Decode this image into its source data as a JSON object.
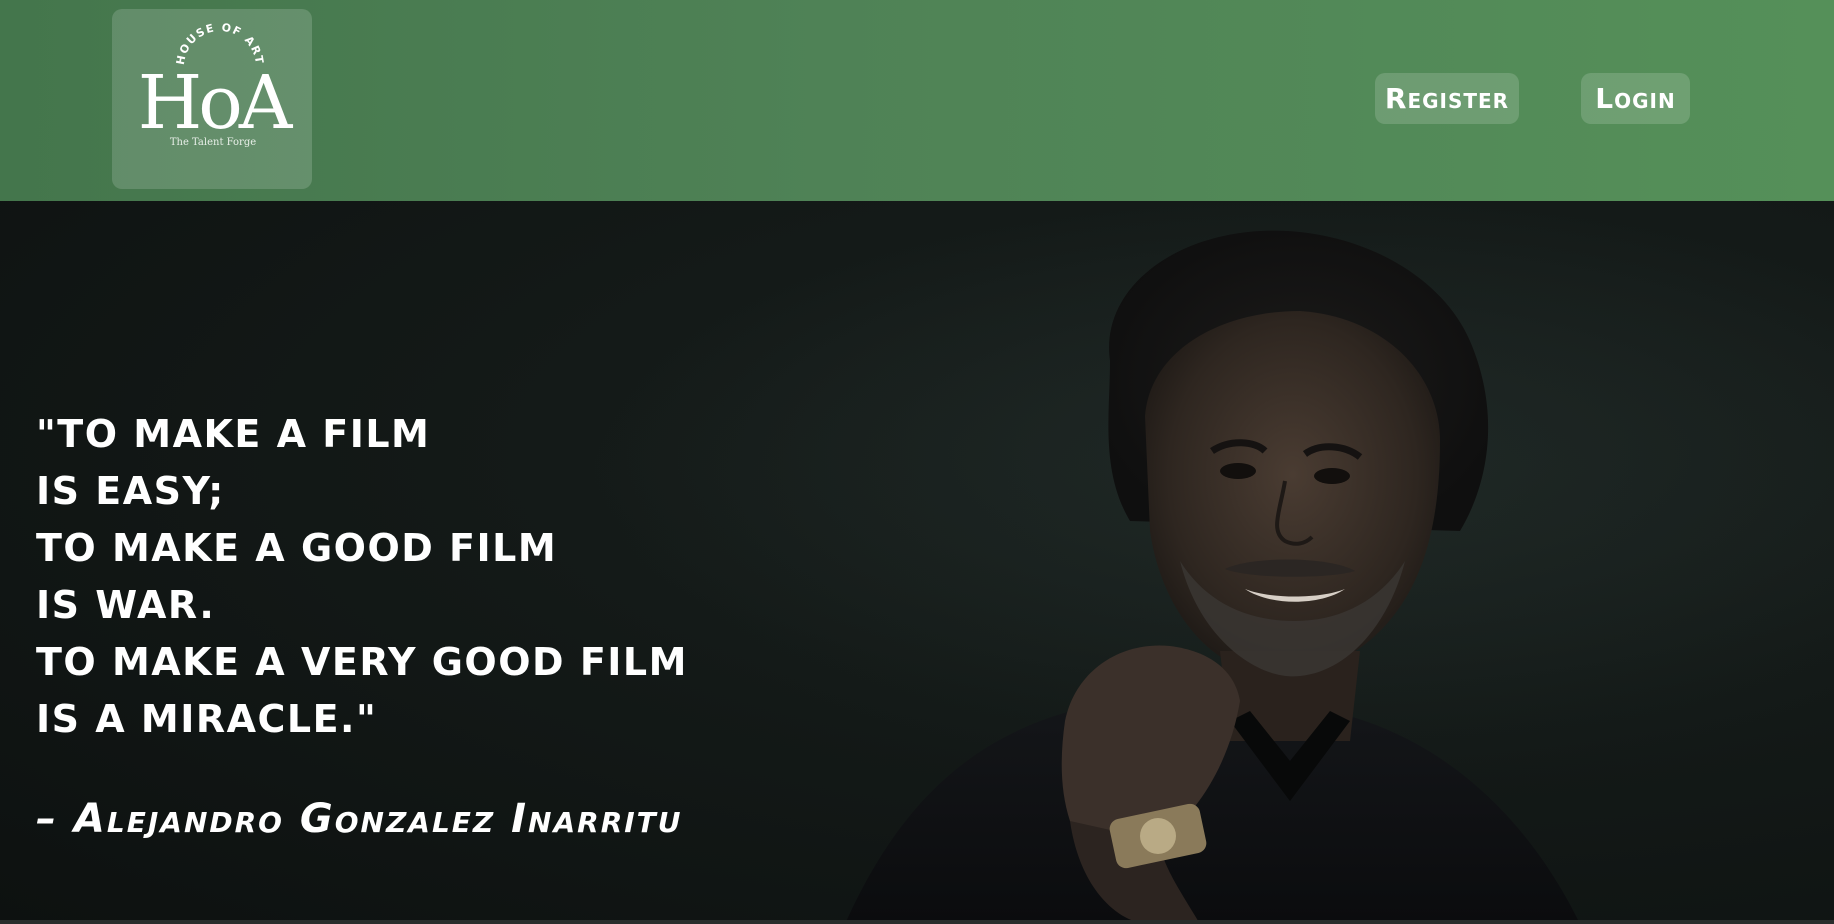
{
  "brand": {
    "arc_text": "HOUSE OF ART",
    "monogram": "HoA",
    "tagline": "The Talent Forge"
  },
  "nav": {
    "register_label": "Register",
    "login_label": "Login"
  },
  "hero": {
    "quote_lines": [
      "\"TO MAKE A FILM",
      "IS EASY;",
      "TO MAKE A GOOD FILM",
      "IS WAR.",
      "TO MAKE A VERY GOOD FILM",
      "IS A MIRACLE.\""
    ],
    "author": "– Alejandro Gonzalez Inarritu"
  },
  "colors": {
    "header_green": "#4f8256",
    "hero_background": "#141a18",
    "text": "#ffffff"
  }
}
